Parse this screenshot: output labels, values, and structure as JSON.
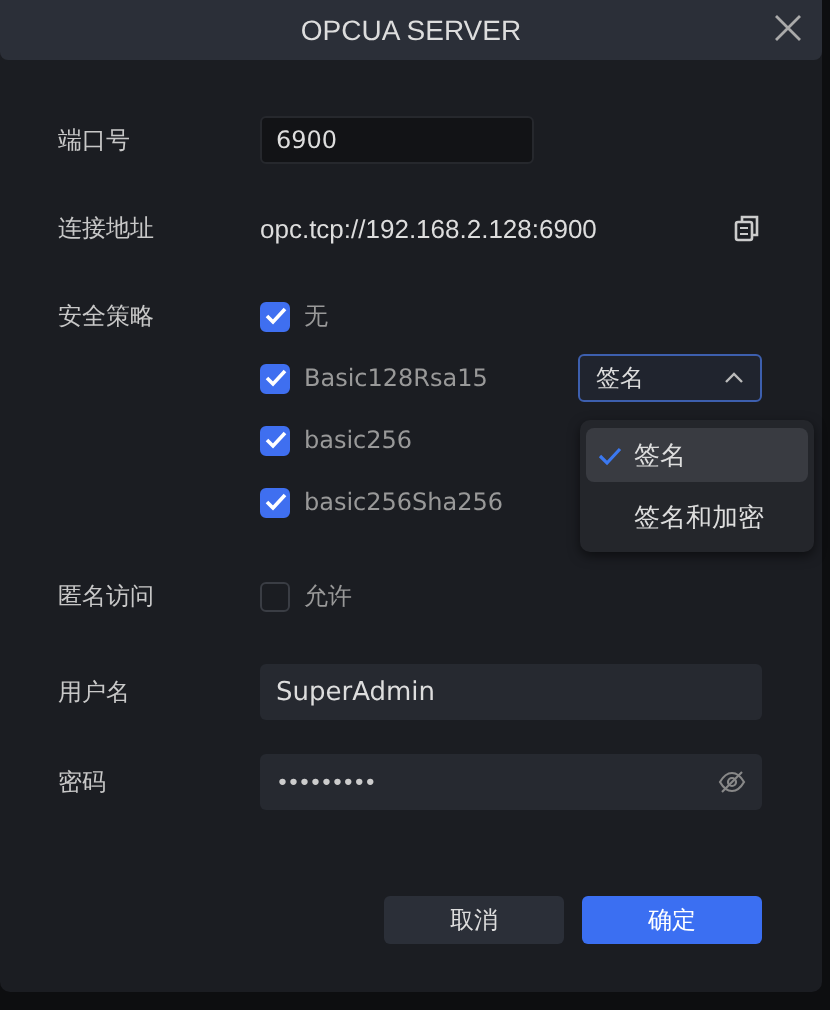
{
  "dialog": {
    "title": "OPCUA SERVER"
  },
  "port": {
    "label": "端口号",
    "value": "6900"
  },
  "address": {
    "label": "连接地址",
    "value": "opc.tcp://192.168.2.128:6900"
  },
  "security": {
    "label": "安全策略",
    "policies": [
      {
        "label": "无",
        "checked": true
      },
      {
        "label": "Basic128Rsa15",
        "checked": true,
        "mode": {
          "value": "签名",
          "expanded": true,
          "options": [
            {
              "label": "签名",
              "selected": true
            },
            {
              "label": "签名和加密",
              "selected": false
            }
          ]
        }
      },
      {
        "label": "basic256",
        "checked": true
      },
      {
        "label": "basic256Sha256",
        "checked": true
      }
    ]
  },
  "anonymous": {
    "label": "匿名访问",
    "option": "允许",
    "checked": false
  },
  "username": {
    "label": "用户名",
    "value": "SuperAdmin"
  },
  "password": {
    "label": "密码",
    "value": "•••••••••"
  },
  "buttons": [
    {
      "label": "取消",
      "kind": "secondary"
    },
    {
      "label": "确定",
      "kind": "primary"
    }
  ]
}
